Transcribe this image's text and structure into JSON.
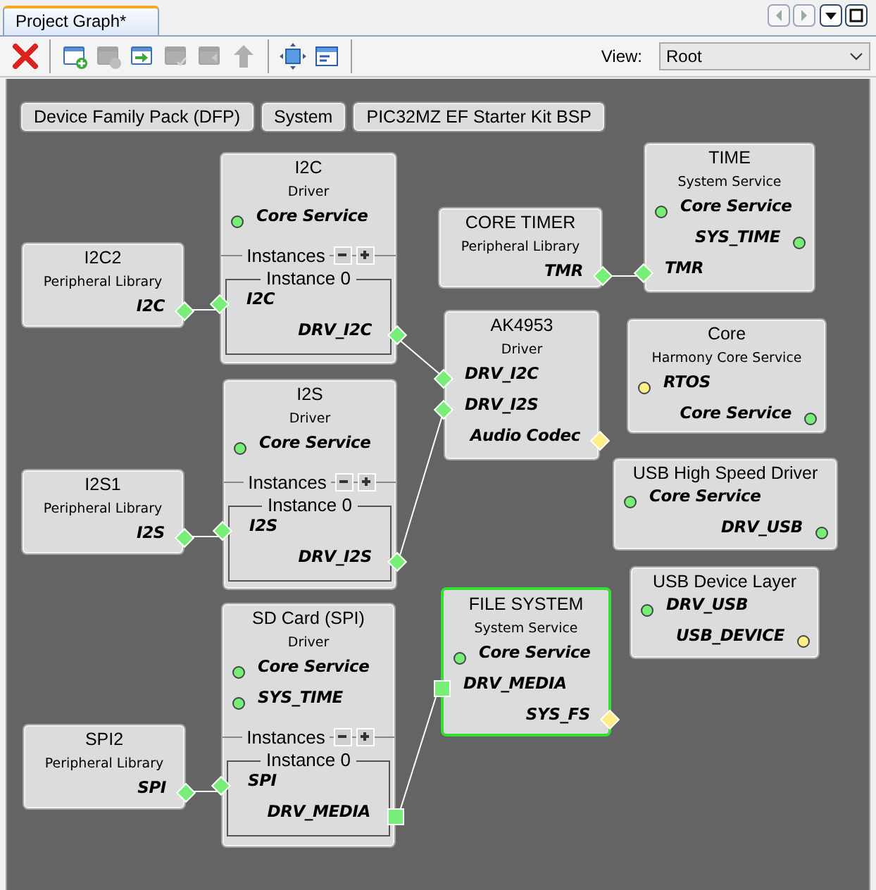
{
  "tab": {
    "label": "Project Graph*",
    "selected": true
  },
  "toolbar": [
    {
      "kind": "delete",
      "disabled": false
    },
    {
      "kind": "add",
      "disabled": false
    },
    {
      "kind": "remove",
      "disabled": true
    },
    {
      "kind": "import",
      "disabled": false
    },
    {
      "kind": "check",
      "disabled": true
    },
    {
      "kind": "export",
      "disabled": true
    },
    {
      "kind": "up",
      "disabled": true
    },
    {
      "kind": "fit",
      "disabled": false
    },
    {
      "kind": "panel",
      "disabled": false
    }
  ],
  "view": {
    "label": "View:",
    "value": "Root"
  },
  "groups": [
    "Device Family Pack (DFP)",
    "System",
    "PIC32MZ EF Starter Kit BSP"
  ],
  "nodes": [
    {
      "title": "I2C2",
      "subtitle": "Peripheral Library",
      "selected": false,
      "ports": [
        {
          "label": "I2C",
          "kind": "out-diamond",
          "color": "#77ee77"
        }
      ]
    },
    {
      "title": "I2C",
      "subtitle": "Driver",
      "selected": false,
      "ports": [
        {
          "label": "Core Service",
          "kind": "in-dot",
          "color": "#77ee77"
        }
      ],
      "instances": {
        "label": "Instances",
        "instance": "Instance 0",
        "ports": [
          {
            "label": "I2C",
            "kind": "in-diamond",
            "color": "#77ee77"
          },
          {
            "label": "DRV_I2C",
            "kind": "out-diamond",
            "color": "#77ee77"
          }
        ]
      }
    },
    {
      "title": "CORE TIMER",
      "subtitle": "Peripheral Library",
      "selected": false,
      "ports": [
        {
          "label": "TMR",
          "kind": "out-diamond",
          "color": "#77ee77"
        }
      ]
    },
    {
      "title": "TIME",
      "subtitle": "System Service",
      "selected": false,
      "ports": [
        {
          "label": "Core Service",
          "kind": "in-dot",
          "color": "#77ee77"
        },
        {
          "label": "SYS_TIME",
          "kind": "out-dot",
          "color": "#77ee77"
        },
        {
          "label": "TMR",
          "kind": "in-diamond",
          "color": "#77ee77"
        }
      ]
    },
    {
      "title": "AK4953",
      "subtitle": "Driver",
      "selected": false,
      "ports": [
        {
          "label": "DRV_I2C",
          "kind": "in-diamond",
          "color": "#77ee77"
        },
        {
          "label": "DRV_I2S",
          "kind": "in-diamond",
          "color": "#77ee77"
        },
        {
          "label": "Audio Codec",
          "kind": "out-diamond",
          "color": "#ffee88"
        }
      ]
    },
    {
      "title": "Core",
      "subtitle": "Harmony Core Service",
      "selected": false,
      "ports": [
        {
          "label": "RTOS",
          "kind": "in-dot",
          "color": "#ffee88"
        },
        {
          "label": "Core Service",
          "kind": "out-dot",
          "color": "#77ee77"
        }
      ]
    },
    {
      "title": "I2S1",
      "subtitle": "Peripheral Library",
      "selected": false,
      "ports": [
        {
          "label": "I2S",
          "kind": "out-diamond",
          "color": "#77ee77"
        }
      ]
    },
    {
      "title": "I2S",
      "subtitle": "Driver",
      "selected": false,
      "ports": [
        {
          "label": "Core Service",
          "kind": "in-dot",
          "color": "#77ee77"
        }
      ],
      "instances": {
        "label": "Instances",
        "instance": "Instance 0",
        "ports": [
          {
            "label": "I2S",
            "kind": "in-diamond",
            "color": "#77ee77"
          },
          {
            "label": "DRV_I2S",
            "kind": "out-diamond",
            "color": "#77ee77"
          }
        ]
      }
    },
    {
      "title": "USB High Speed Driver",
      "selected": false,
      "ports": [
        {
          "label": "Core Service",
          "kind": "in-dot",
          "color": "#77ee77"
        },
        {
          "label": "DRV_USB",
          "kind": "out-dot",
          "color": "#77ee77"
        }
      ]
    },
    {
      "title": "SPI2",
      "subtitle": "Peripheral Library",
      "selected": false,
      "ports": [
        {
          "label": "SPI",
          "kind": "out-diamond",
          "color": "#77ee77"
        }
      ]
    },
    {
      "title": "SD Card (SPI)",
      "subtitle": "Driver",
      "selected": false,
      "ports": [
        {
          "label": "Core Service",
          "kind": "in-dot",
          "color": "#77ee77"
        },
        {
          "label": "SYS_TIME",
          "kind": "in-dot",
          "color": "#77ee77"
        }
      ],
      "instances": {
        "label": "Instances",
        "instance": "Instance 0",
        "ports": [
          {
            "label": "SPI",
            "kind": "in-diamond",
            "color": "#77ee77"
          },
          {
            "label": "DRV_MEDIA",
            "kind": "out-square",
            "color": "#77ee77"
          }
        ]
      }
    },
    {
      "title": "FILE SYSTEM",
      "subtitle": "System Service",
      "selected": true,
      "ports": [
        {
          "label": "Core Service",
          "kind": "in-dot",
          "color": "#77ee77"
        },
        {
          "label": "DRV_MEDIA",
          "kind": "in-square",
          "color": "#77ee77"
        },
        {
          "label": "SYS_FS",
          "kind": "out-diamond",
          "color": "#ffee88"
        }
      ]
    },
    {
      "title": "USB Device Layer",
      "selected": false,
      "ports": [
        {
          "label": "DRV_USB",
          "kind": "in-dot",
          "color": "#77ee77"
        },
        {
          "label": "USB_DEVICE",
          "kind": "out-dot",
          "color": "#ffee88"
        }
      ]
    }
  ]
}
